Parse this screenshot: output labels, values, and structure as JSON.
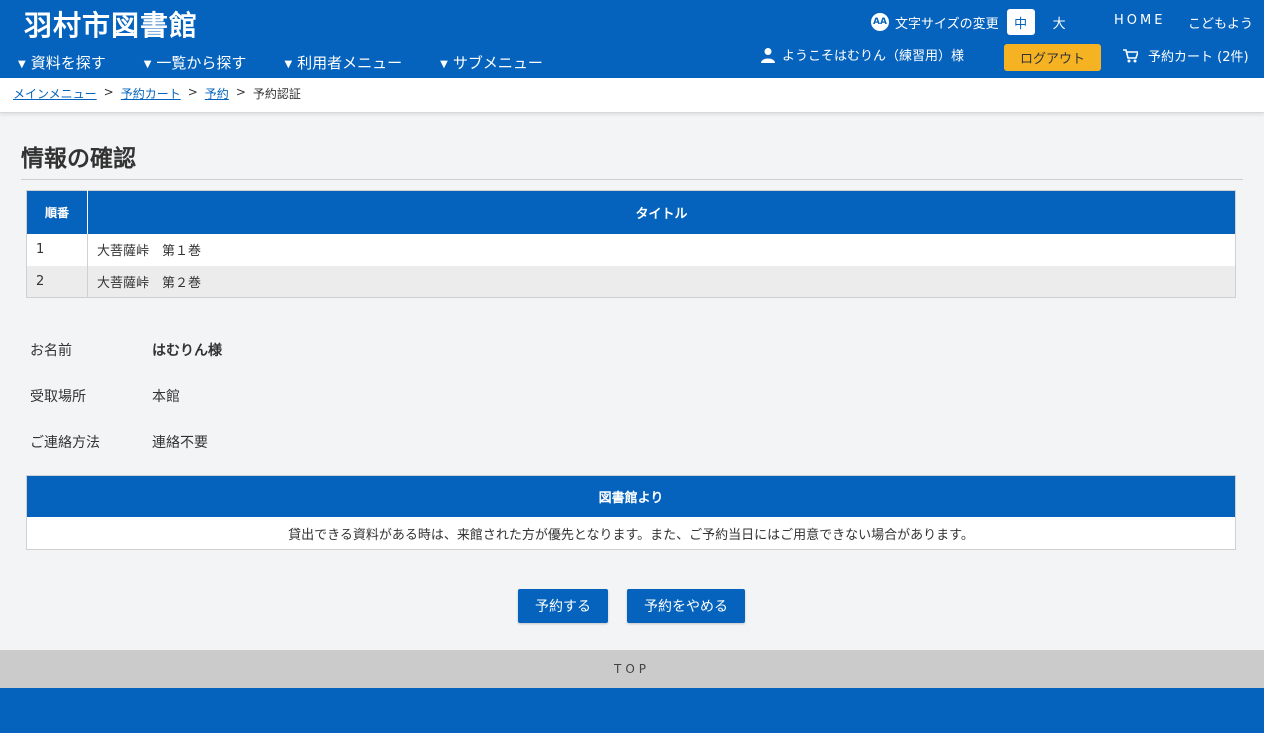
{
  "header": {
    "site_title": "羽村市図書館",
    "nav": [
      "資料を探す",
      "一覧から探す",
      "利用者メニュー",
      "サブメニュー"
    ],
    "font_size": {
      "icon_text": "AA",
      "label": "文字サイズの変更",
      "mid": "中",
      "large": "大"
    },
    "home": "HOME",
    "kids": "こどもよう",
    "welcome": "ようこそはむりん（練習用）様",
    "logout": "ログアウト",
    "cart": "予約カート (2件)"
  },
  "breadcrumb": {
    "items": [
      "メインメニュー",
      "予約カート",
      "予約"
    ],
    "current": "予約認証",
    "separator": ">"
  },
  "page_title": "情報の確認",
  "table": {
    "headers": [
      "順番",
      "タイトル"
    ],
    "rows": [
      {
        "no": "1",
        "title": "大菩薩峠　第１巻"
      },
      {
        "no": "2",
        "title": "大菩薩峠　第２巻"
      }
    ]
  },
  "info": [
    {
      "label": "お名前",
      "value": "はむりん様"
    },
    {
      "label": "受取場所",
      "value": "本館"
    },
    {
      "label": "ご連絡方法",
      "value": "連絡不要"
    }
  ],
  "notice": {
    "heading": "図書館より",
    "body": "貸出できる資料がある時は、来館された方が優先となります。また、ご予約当日にはご用意できない場合があります。"
  },
  "buttons": {
    "reserve": "予約する",
    "cancel": "予約をやめる"
  },
  "top_link": "TOP",
  "colors": {
    "primary": "#0563bd",
    "logout": "#f5b324",
    "top_bar": "#cbcbcb",
    "background": "#f3f4f6"
  }
}
